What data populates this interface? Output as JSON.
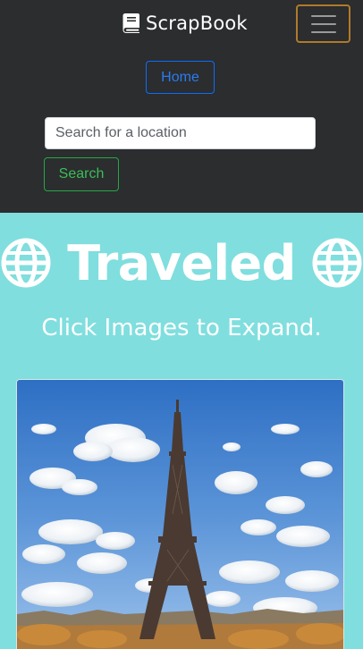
{
  "navbar": {
    "brand": "ScrapBook",
    "home_label": "Home",
    "search_placeholder": "Search for a location",
    "search_value": "",
    "search_button_label": "Search"
  },
  "main": {
    "title": "Traveled",
    "subtitle": "Click Images to Expand."
  },
  "colors": {
    "navbar_bg": "#2b2d2f",
    "page_bg": "#80dede",
    "home_outline": "#0d6efd",
    "search_outline": "#28a745",
    "toggler_border": "#b07a2a"
  },
  "icons": [
    "book-icon",
    "hamburger-icon",
    "globe-icon"
  ]
}
